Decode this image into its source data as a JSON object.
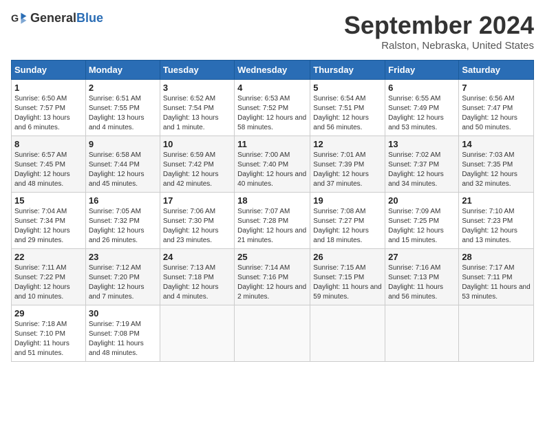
{
  "logo": {
    "general": "General",
    "blue": "Blue"
  },
  "title": "September 2024",
  "location": "Ralston, Nebraska, United States",
  "days_of_week": [
    "Sunday",
    "Monday",
    "Tuesday",
    "Wednesday",
    "Thursday",
    "Friday",
    "Saturday"
  ],
  "weeks": [
    [
      {
        "day": "1",
        "info": "Sunrise: 6:50 AM\nSunset: 7:57 PM\nDaylight: 13 hours and 6 minutes."
      },
      {
        "day": "2",
        "info": "Sunrise: 6:51 AM\nSunset: 7:55 PM\nDaylight: 13 hours and 4 minutes."
      },
      {
        "day": "3",
        "info": "Sunrise: 6:52 AM\nSunset: 7:54 PM\nDaylight: 13 hours and 1 minute."
      },
      {
        "day": "4",
        "info": "Sunrise: 6:53 AM\nSunset: 7:52 PM\nDaylight: 12 hours and 58 minutes."
      },
      {
        "day": "5",
        "info": "Sunrise: 6:54 AM\nSunset: 7:51 PM\nDaylight: 12 hours and 56 minutes."
      },
      {
        "day": "6",
        "info": "Sunrise: 6:55 AM\nSunset: 7:49 PM\nDaylight: 12 hours and 53 minutes."
      },
      {
        "day": "7",
        "info": "Sunrise: 6:56 AM\nSunset: 7:47 PM\nDaylight: 12 hours and 50 minutes."
      }
    ],
    [
      {
        "day": "8",
        "info": "Sunrise: 6:57 AM\nSunset: 7:45 PM\nDaylight: 12 hours and 48 minutes."
      },
      {
        "day": "9",
        "info": "Sunrise: 6:58 AM\nSunset: 7:44 PM\nDaylight: 12 hours and 45 minutes."
      },
      {
        "day": "10",
        "info": "Sunrise: 6:59 AM\nSunset: 7:42 PM\nDaylight: 12 hours and 42 minutes."
      },
      {
        "day": "11",
        "info": "Sunrise: 7:00 AM\nSunset: 7:40 PM\nDaylight: 12 hours and 40 minutes."
      },
      {
        "day": "12",
        "info": "Sunrise: 7:01 AM\nSunset: 7:39 PM\nDaylight: 12 hours and 37 minutes."
      },
      {
        "day": "13",
        "info": "Sunrise: 7:02 AM\nSunset: 7:37 PM\nDaylight: 12 hours and 34 minutes."
      },
      {
        "day": "14",
        "info": "Sunrise: 7:03 AM\nSunset: 7:35 PM\nDaylight: 12 hours and 32 minutes."
      }
    ],
    [
      {
        "day": "15",
        "info": "Sunrise: 7:04 AM\nSunset: 7:34 PM\nDaylight: 12 hours and 29 minutes."
      },
      {
        "day": "16",
        "info": "Sunrise: 7:05 AM\nSunset: 7:32 PM\nDaylight: 12 hours and 26 minutes."
      },
      {
        "day": "17",
        "info": "Sunrise: 7:06 AM\nSunset: 7:30 PM\nDaylight: 12 hours and 23 minutes."
      },
      {
        "day": "18",
        "info": "Sunrise: 7:07 AM\nSunset: 7:28 PM\nDaylight: 12 hours and 21 minutes."
      },
      {
        "day": "19",
        "info": "Sunrise: 7:08 AM\nSunset: 7:27 PM\nDaylight: 12 hours and 18 minutes."
      },
      {
        "day": "20",
        "info": "Sunrise: 7:09 AM\nSunset: 7:25 PM\nDaylight: 12 hours and 15 minutes."
      },
      {
        "day": "21",
        "info": "Sunrise: 7:10 AM\nSunset: 7:23 PM\nDaylight: 12 hours and 13 minutes."
      }
    ],
    [
      {
        "day": "22",
        "info": "Sunrise: 7:11 AM\nSunset: 7:22 PM\nDaylight: 12 hours and 10 minutes."
      },
      {
        "day": "23",
        "info": "Sunrise: 7:12 AM\nSunset: 7:20 PM\nDaylight: 12 hours and 7 minutes."
      },
      {
        "day": "24",
        "info": "Sunrise: 7:13 AM\nSunset: 7:18 PM\nDaylight: 12 hours and 4 minutes."
      },
      {
        "day": "25",
        "info": "Sunrise: 7:14 AM\nSunset: 7:16 PM\nDaylight: 12 hours and 2 minutes."
      },
      {
        "day": "26",
        "info": "Sunrise: 7:15 AM\nSunset: 7:15 PM\nDaylight: 11 hours and 59 minutes."
      },
      {
        "day": "27",
        "info": "Sunrise: 7:16 AM\nSunset: 7:13 PM\nDaylight: 11 hours and 56 minutes."
      },
      {
        "day": "28",
        "info": "Sunrise: 7:17 AM\nSunset: 7:11 PM\nDaylight: 11 hours and 53 minutes."
      }
    ],
    [
      {
        "day": "29",
        "info": "Sunrise: 7:18 AM\nSunset: 7:10 PM\nDaylight: 11 hours and 51 minutes."
      },
      {
        "day": "30",
        "info": "Sunrise: 7:19 AM\nSunset: 7:08 PM\nDaylight: 11 hours and 48 minutes."
      },
      null,
      null,
      null,
      null,
      null
    ]
  ]
}
